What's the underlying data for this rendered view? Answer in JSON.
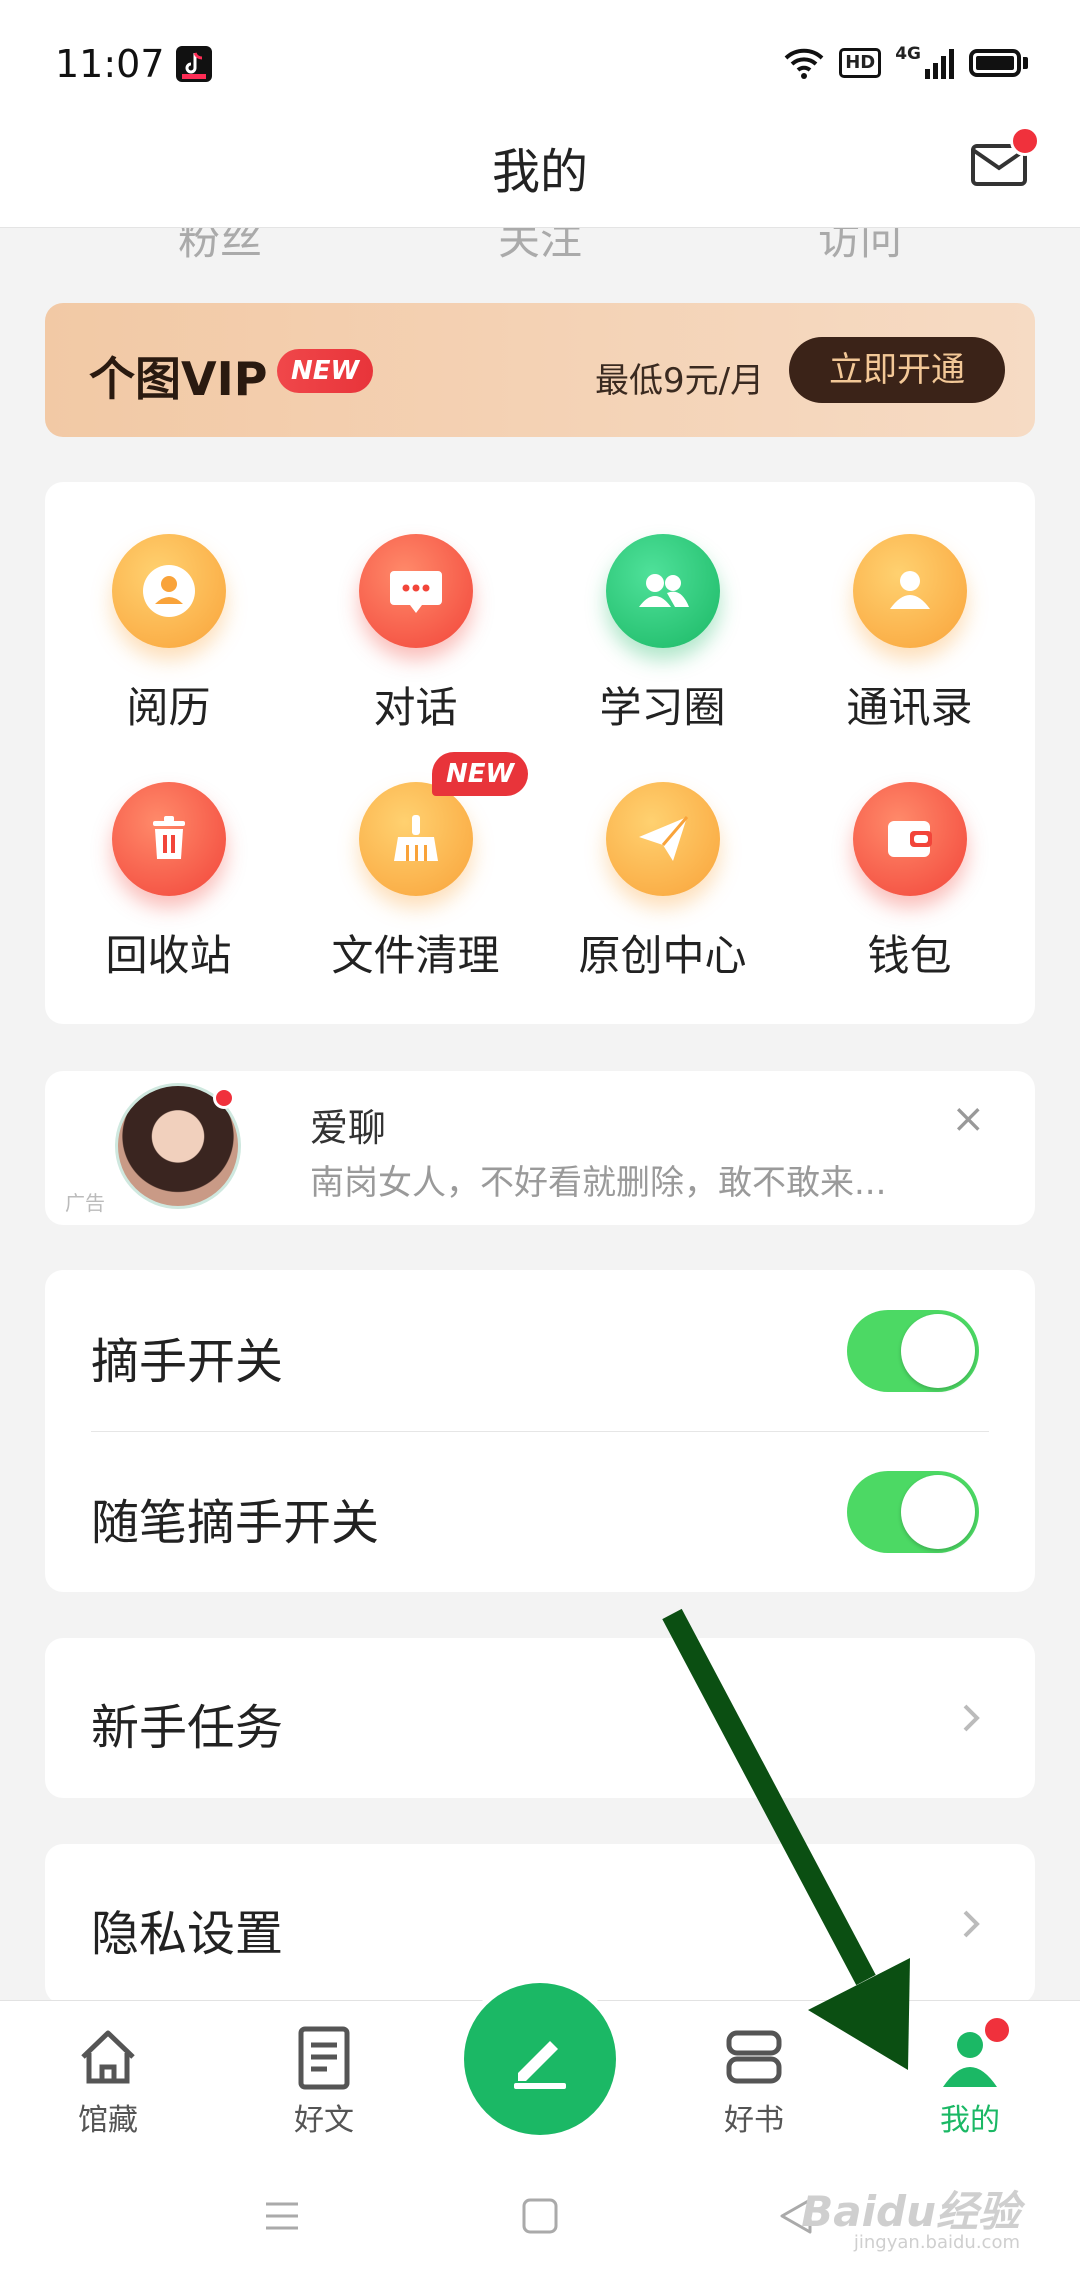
{
  "status_bar": {
    "time": "11:07",
    "hd": "HD",
    "network": "4G"
  },
  "header": {
    "title": "我的"
  },
  "stats": [
    {
      "label": "粉丝"
    },
    {
      "label": "关注"
    },
    {
      "label": "访问"
    }
  ],
  "vip": {
    "title": "个图VIP",
    "badge": "NEW",
    "price": "最低9元/月",
    "button": "立即开通"
  },
  "grid": [
    {
      "label": "阅历",
      "icon": "user-circle-icon"
    },
    {
      "label": "对话",
      "icon": "chat-bubble-icon"
    },
    {
      "label": "学习圈",
      "icon": "group-icon"
    },
    {
      "label": "通讯录",
      "icon": "contact-icon"
    },
    {
      "label": "回收站",
      "icon": "trash-icon"
    },
    {
      "label": "文件清理",
      "icon": "broom-icon",
      "badge": "NEW"
    },
    {
      "label": "原创中心",
      "icon": "paper-plane-icon"
    },
    {
      "label": "钱包",
      "icon": "wallet-icon"
    }
  ],
  "ad": {
    "tag": "广告",
    "title": "爱聊",
    "description": "南岗女人，不好看就删除，敢不敢来...",
    "close": "×"
  },
  "toggles": [
    {
      "label": "摘手开关",
      "on": true
    },
    {
      "label": "随笔摘手开关",
      "on": true
    }
  ],
  "links": [
    {
      "label": "新手任务"
    },
    {
      "label": "隐私设置"
    }
  ],
  "bottom_nav": [
    {
      "label": "馆藏",
      "icon": "home-icon"
    },
    {
      "label": "好文",
      "icon": "document-icon"
    },
    {
      "label": "",
      "icon": "pencil-icon"
    },
    {
      "label": "好书",
      "icon": "book-icon"
    },
    {
      "label": "我的",
      "icon": "profile-icon",
      "active": true
    }
  ],
  "watermark": {
    "brand": "Baidu经验",
    "url": "jingyan.baidu.com"
  },
  "colors": {
    "accent": "#1bb865",
    "vip_button": "#3b2318",
    "badge_red": "#e8343a",
    "toggle_on": "#4cd964",
    "annotation_arrow": "#0b4f12"
  }
}
